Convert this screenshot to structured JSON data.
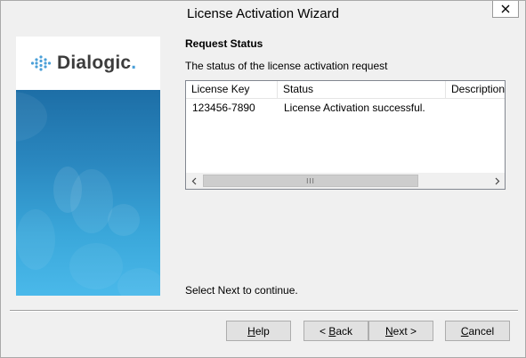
{
  "window": {
    "title": "License Activation Wizard"
  },
  "banner": {
    "logo_text": "Dialogic",
    "logo_suffix": ".",
    "colors": {
      "top": "#1d6ea6",
      "bottom": "#4ab9ea"
    }
  },
  "content": {
    "heading": "Request Status",
    "subheading": "The status of the license activation request",
    "instruction": "Select Next to continue."
  },
  "table": {
    "columns": [
      "License Key",
      "Status",
      "Description"
    ],
    "rows": [
      [
        "123456-7890",
        "License Activation successful.",
        ""
      ]
    ]
  },
  "buttons": {
    "help": {
      "pre": "",
      "access": "H",
      "post": "elp"
    },
    "back": {
      "pre": "< ",
      "access": "B",
      "post": "ack"
    },
    "next": {
      "pre": "",
      "access": "N",
      "post": "ext >"
    },
    "cancel": {
      "pre": "",
      "access": "C",
      "post": "ancel"
    }
  }
}
